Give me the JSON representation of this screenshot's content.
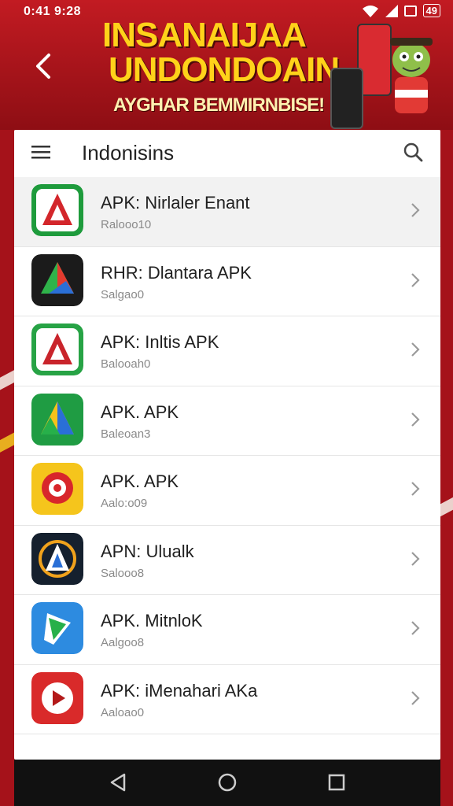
{
  "status": {
    "time": "0:41 9:28",
    "battery": "49"
  },
  "banner": {
    "line1": "INSANAIJAA",
    "line2": "UNDONDOAIN",
    "tagline": "AYGHAR BEMMIRNBISE!"
  },
  "toolbar": {
    "title": "Indonisins"
  },
  "apps": [
    {
      "name": "APK: Nirlaler Enant",
      "sub": "Ralooo10",
      "colors": [
        "#1e9b3c",
        "#d3262b",
        "#ffffff"
      ]
    },
    {
      "name": "RHR: Dlantara APK",
      "sub": "Salgao0",
      "colors": [
        "#1b1b1b",
        "#2fb34a",
        "#e33b2f"
      ]
    },
    {
      "name": "APK: Inltis APK",
      "sub": "Balooah0",
      "colors": [
        "#27a345",
        "#ffffff",
        "#c9242b"
      ]
    },
    {
      "name": "APK. APK",
      "sub": "Baleoan3",
      "colors": [
        "#1f9c43",
        "#f4c21b",
        "#2a6fd6"
      ]
    },
    {
      "name": "APK. APK",
      "sub": "Aalo:o09",
      "colors": [
        "#f5c51c",
        "#d8262b",
        "#ffffff"
      ]
    },
    {
      "name": "APN: Ulualk",
      "sub": "Salooo8",
      "colors": [
        "#15202e",
        "#ffffff",
        "#f0a21c"
      ]
    },
    {
      "name": "APK. MitnloK",
      "sub": "Aalgoo8",
      "colors": [
        "#2d8be0",
        "#ffffff",
        "#27b04a"
      ]
    },
    {
      "name": "APK: iMenahari AKa",
      "sub": "Aaloao0",
      "colors": [
        "#d92a2a",
        "#ffffff",
        "#b31a1a"
      ]
    }
  ]
}
